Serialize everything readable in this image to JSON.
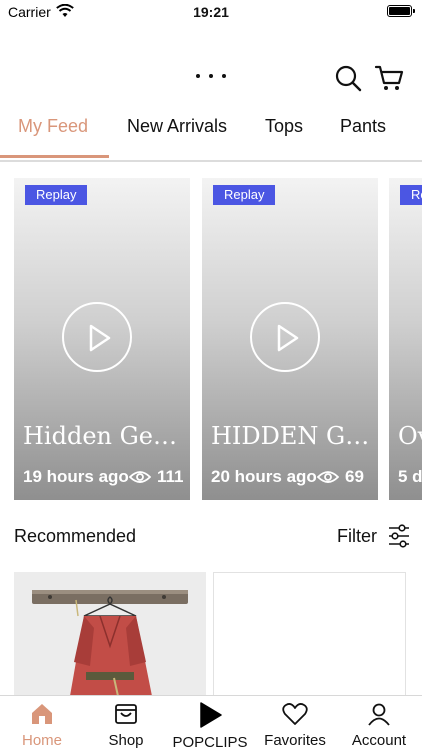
{
  "status_bar": {
    "carrier": "Carrier",
    "time": "19:21"
  },
  "tabs": [
    {
      "label": "My Feed",
      "active": true
    },
    {
      "label": "New Arrivals",
      "active": false
    },
    {
      "label": "Tops",
      "active": false
    },
    {
      "label": "Pants",
      "active": false
    }
  ],
  "videos": [
    {
      "badge": "Replay",
      "title": "Hidden Gem...",
      "ago": "19 hours ago",
      "views": "111"
    },
    {
      "badge": "Replay",
      "title": "HIDDEN GE...",
      "ago": "20 hours ago",
      "views": "69"
    },
    {
      "badge": "Re",
      "title": "Ov",
      "ago": "5 d",
      "views": ""
    }
  ],
  "recommended": {
    "title": "Recommended",
    "filter_label": "Filter"
  },
  "bottom_nav": [
    {
      "label": "Home",
      "icon": "home-icon",
      "active": true
    },
    {
      "label": "Shop",
      "icon": "shop-icon",
      "active": false
    },
    {
      "label": "POPCLIPS",
      "icon": "play-icon",
      "active": false
    },
    {
      "label": "Favorites",
      "icon": "heart-icon",
      "active": false
    },
    {
      "label": "Account",
      "icon": "person-icon",
      "active": false
    }
  ],
  "colors": {
    "accent": "#d9967a",
    "badge": "#4b56e3"
  }
}
